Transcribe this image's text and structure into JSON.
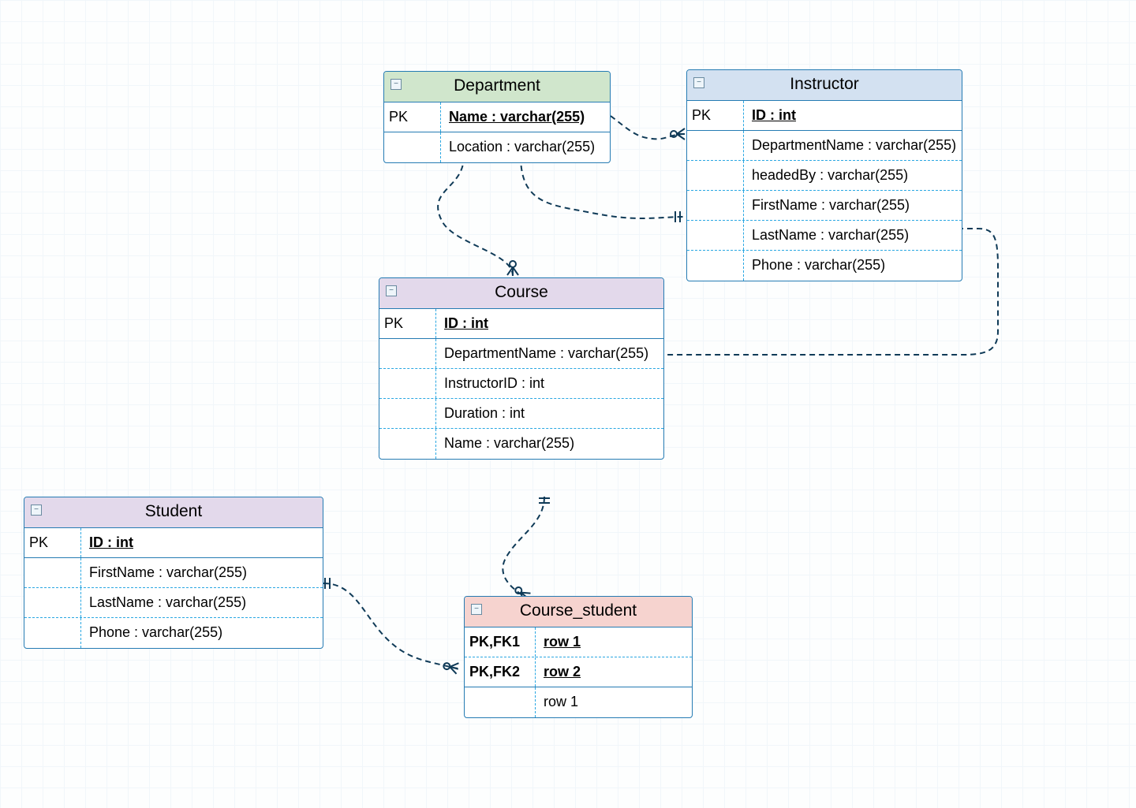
{
  "entities": {
    "department": {
      "title": "Department",
      "pk_key": "PK",
      "pk_label": "Name : varchar(255)",
      "attrs": [
        {
          "key": "",
          "label": "Location : varchar(255)"
        }
      ]
    },
    "instructor": {
      "title": "Instructor",
      "pk_key": "PK",
      "pk_label": "ID : int",
      "attrs": [
        {
          "key": "",
          "label": "DepartmentName : varchar(255)"
        },
        {
          "key": "",
          "label": "headedBy : varchar(255)"
        },
        {
          "key": "",
          "label": "FirstName : varchar(255)"
        },
        {
          "key": "",
          "label": "LastName : varchar(255)"
        },
        {
          "key": "",
          "label": "Phone : varchar(255)"
        }
      ]
    },
    "course": {
      "title": "Course",
      "pk_key": "PK",
      "pk_label": "ID : int",
      "attrs": [
        {
          "key": "",
          "label": "DepartmentName : varchar(255)"
        },
        {
          "key": "",
          "label": "InstructorID : int"
        },
        {
          "key": "",
          "label": "Duration : int"
        },
        {
          "key": "",
          "label": "Name : varchar(255)"
        }
      ]
    },
    "student": {
      "title": "Student",
      "pk_key": "PK",
      "pk_label": "ID : int",
      "attrs": [
        {
          "key": "",
          "label": "FirstName : varchar(255)"
        },
        {
          "key": "",
          "label": "LastName : varchar(255)"
        },
        {
          "key": "",
          "label": "Phone : varchar(255)"
        }
      ]
    },
    "course_student": {
      "title": "Course_student",
      "rows": [
        {
          "key": "PK,FK1",
          "label": "row 1"
        },
        {
          "key": "PK,FK2",
          "label": "row 2"
        },
        {
          "key": "",
          "label": "row 1"
        }
      ]
    }
  },
  "collapse_glyph": "−"
}
